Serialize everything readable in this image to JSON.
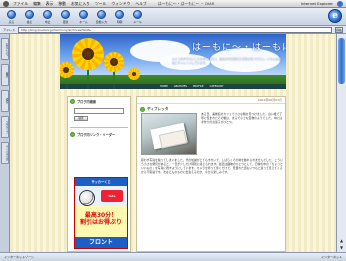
{
  "menubar": {
    "items": [
      "ファイル",
      "編集",
      "表示",
      "移動",
      "お気に入り",
      "ツール",
      "ウィンドウ",
      "ヘルプ"
    ],
    "app": "Internet Explorer",
    "title": "はーもに～・はーもに～ ~ DIAR"
  },
  "toolbar": {
    "buttons": [
      "戻る",
      "進む",
      "中止",
      "更新",
      "ホーム",
      "自動入力",
      "印刷",
      "メール"
    ]
  },
  "address": {
    "label": "アドレス",
    "url": "http://blog.livedoor.jp/harmony/archives/50dfa",
    "go": "移動"
  },
  "explorer": {
    "tabs": [
      "お気に入り",
      "履歴",
      "検索",
      "スクラップ",
      "ページホルダ"
    ]
  },
  "banner": {
    "title": "はーもに～・はーもに～",
    "description": "ひとつのやりたいことを見つけたい。自分の中の隠れた才能を見つけたい。いろんな趣味にチャレンジしています。",
    "nav": [
      "HOME",
      "ARCHIVES",
      "PROFILE",
      "CATEGORY"
    ]
  },
  "sidebar": {
    "search_heading": "ブログ内検索",
    "search_button": "検索",
    "links_heading": "ブログ内リンク・リーダー",
    "ad": {
      "head": "サッカーくじ",
      "badge": "toto",
      "main": "最高30分！\n割引はお得ぶり",
      "foot": "フロント"
    }
  },
  "post": {
    "date": "2004年06月03日",
    "title": "ディプレッタ",
    "para1": "ある日、美術館のカフェで小さな箱を見つけました。白い紙で丁寧に包まれたその箱は、まるで小さな宝物のようでした。中には手作りのお菓子がひとつ。",
    "para2": "思わず写真を撮ってしまいました。光の加減がとてもきれいで、しばらくその場を離れられませんでした。こういう小さな発見があると、一日が少しだけ特別に感じられます。最近は趣味のひとつとして、日常の中の「ちょっといいもの」を写真に残すようにしています。カメラを持って歩くだけで、見慣れた街もいつもと違って見えてくるから不思議です。次はどんなものに出会えるのか、今から楽しみです。"
  },
  "status": {
    "left": "インターネットゾーン",
    "zone": "インターネット"
  }
}
